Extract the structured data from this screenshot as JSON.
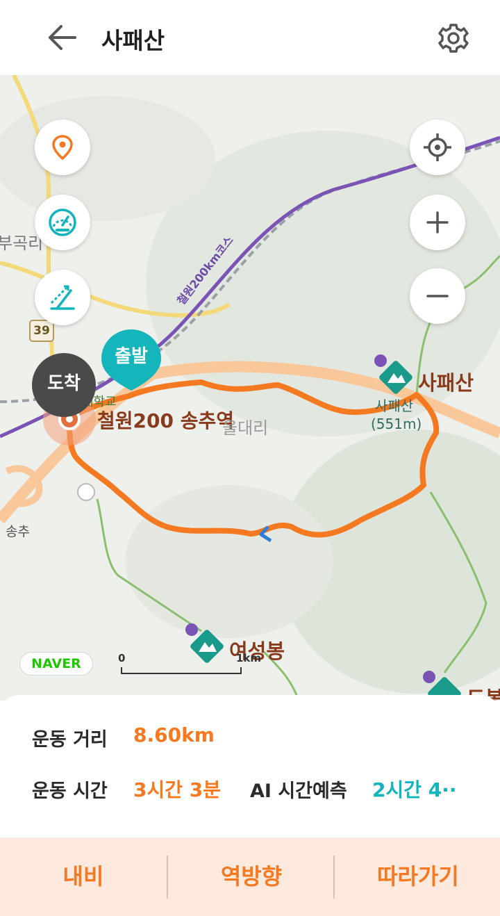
{
  "header": {
    "title": "사패산",
    "back_icon": "arrow-left-icon",
    "settings_icon": "gear-icon"
  },
  "map": {
    "labels": {
      "course_line": "철원200km코스",
      "place_left": "부곡리",
      "route_badge": "39",
      "school": "대학교",
      "station": "철원200 송추역",
      "village": "울대리",
      "peak_main_name": "사패산",
      "peak_main_small": "사패산",
      "peak_main_height": "(551m)",
      "songchu": "송추",
      "peak_yeoseong": "여성봉",
      "peak_dobong": "도봉"
    },
    "start_label": "출발",
    "end_label": "도착",
    "naver_logo": "NAVER",
    "scale": {
      "zero": "0",
      "one": "1km"
    },
    "left_controls": [
      "location-pin-icon",
      "speedometer-icon",
      "elevation-icon"
    ],
    "right_controls": [
      "crosshair-icon",
      "plus-icon",
      "minus-icon"
    ]
  },
  "info": {
    "distance_label": "운동 거리",
    "distance_value": "8.60km",
    "time_label": "운동 시간",
    "time_value": "3시간 3분",
    "ai_label": "AI 시간예측",
    "ai_value": "2시간 4··"
  },
  "actions": {
    "navi": "내비",
    "reverse": "역방향",
    "follow": "따라가기"
  },
  "colors": {
    "accent": "#f47920",
    "teal": "#13b5bc",
    "route": "#f47920",
    "course_line": "#7a54b4"
  }
}
